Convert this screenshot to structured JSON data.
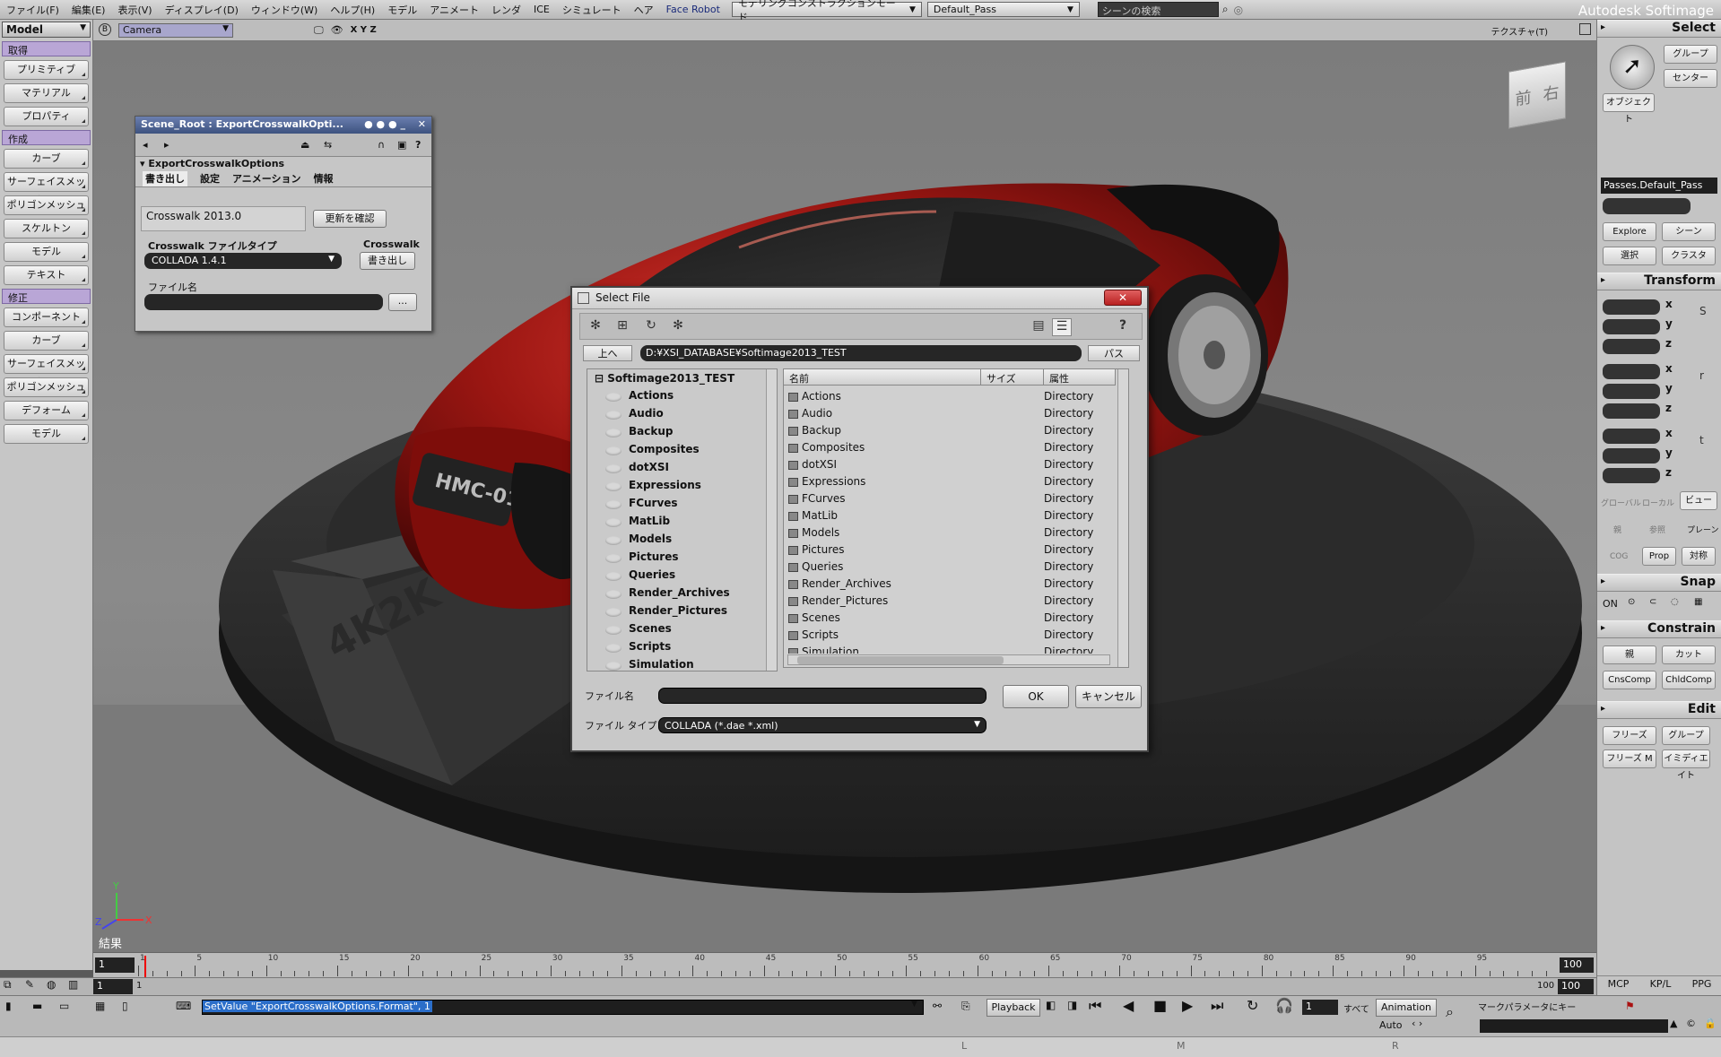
{
  "menubar": {
    "items": [
      "ファイル(F)",
      "編集(E)",
      "表示(V)",
      "ディスプレイ(D)",
      "ウィンドウ(W)",
      "ヘルプ(H)",
      "モデル",
      "アニメート",
      "レンダ",
      "ICE",
      "シミュレート",
      "ヘア",
      "Face Robot"
    ],
    "mode_dropdown": "モデリングコンストラクションモード",
    "pass_dropdown": "Default_Pass",
    "search_placeholder": "シーンの検索",
    "brand": "Autodesk Softimage"
  },
  "left_toolbar": {
    "mode": "Model",
    "sections": [
      {
        "title": "取得",
        "buttons": [
          "プリミティブ",
          "マテリアル",
          "プロパティ"
        ]
      },
      {
        "title": "作成",
        "buttons": [
          "カーブ",
          "サーフェイスメッシュ",
          "ポリゴンメッシュ",
          "スケルトン",
          "モデル",
          "テキスト"
        ]
      },
      {
        "title": "修正",
        "buttons": [
          "コンポーネント",
          "カーブ",
          "サーフェイスメッシュ",
          "ポリゴンメッシュ",
          "デフォーム",
          "モデル"
        ]
      }
    ]
  },
  "viewport": {
    "camera": "Camera",
    "axes": "X Y Z",
    "texture_label": "テクスチャ(T)",
    "result_label": "結果",
    "cube_labels": [
      "前",
      "右"
    ],
    "plate_text": "HMC-01",
    "pedestal_text": "4K2K"
  },
  "property_panel": {
    "title": "Scene_Root : ExportCrosswalkOpti...",
    "section": "ExportCrosswalkOptions",
    "tabs": [
      "書き出し",
      "設定",
      "アニメーション",
      "情報"
    ],
    "version": "Crosswalk 2013.0",
    "update_button": "更新を確認",
    "filetype_label": "Crosswalk ファイルタイプ",
    "filetype_value": "COLLADA 1.4.1",
    "crosswalk_label": "Crosswalk",
    "export_button": "書き出し",
    "filename_label": "ファイル名",
    "browse_button": "..."
  },
  "dialog": {
    "title": "Select File",
    "close": "✕",
    "up_button": "上へ",
    "path": "D:¥XSI_DATABASE¥Softimage2013_TEST",
    "path_button": "パス",
    "tree_root": "Softimage2013_TEST",
    "tree_items": [
      "Actions",
      "Audio",
      "Backup",
      "Composites",
      "dotXSI",
      "Expressions",
      "FCurves",
      "MatLib",
      "Models",
      "Pictures",
      "Queries",
      "Render_Archives",
      "Render_Pictures",
      "Scenes",
      "Scripts",
      "Simulation"
    ],
    "columns": [
      "名前",
      "サイズ",
      "属性"
    ],
    "files": [
      {
        "name": "Actions",
        "attr": "Directory"
      },
      {
        "name": "Audio",
        "attr": "Directory"
      },
      {
        "name": "Backup",
        "attr": "Directory"
      },
      {
        "name": "Composites",
        "attr": "Directory"
      },
      {
        "name": "dotXSI",
        "attr": "Directory"
      },
      {
        "name": "Expressions",
        "attr": "Directory"
      },
      {
        "name": "FCurves",
        "attr": "Directory"
      },
      {
        "name": "MatLib",
        "attr": "Directory"
      },
      {
        "name": "Models",
        "attr": "Directory"
      },
      {
        "name": "Pictures",
        "attr": "Directory"
      },
      {
        "name": "Queries",
        "attr": "Directory"
      },
      {
        "name": "Render_Archives",
        "attr": "Directory"
      },
      {
        "name": "Render_Pictures",
        "attr": "Directory"
      },
      {
        "name": "Scenes",
        "attr": "Directory"
      },
      {
        "name": "Scripts",
        "attr": "Directory"
      },
      {
        "name": "Simulation",
        "attr": "Directory"
      }
    ],
    "filename_label": "ファイル名",
    "filename_value": "",
    "filetype_label": "ファイル タイプ",
    "filetype_value": "COLLADA (*.dae *.xml)",
    "ok": "OK",
    "cancel": "キャンセル"
  },
  "right_panel": {
    "select_header": "Select",
    "group_button": "グループ",
    "center_button": "センター",
    "object_button": "オブジェクト",
    "pass_field": "Passes.Default_Pass",
    "explore_button": "Explore",
    "scene_button": "シーン",
    "select_button": "選択",
    "cluster_button": "クラスタ",
    "transform_header": "Transform",
    "axes": [
      "x",
      "y",
      "z"
    ],
    "ref_buttons": [
      "グローバル",
      "ローカル",
      "ビュー",
      "親",
      "参照",
      "プレーン",
      "COG",
      "Prop",
      "対称"
    ],
    "snap_header": "Snap",
    "snap_on": "ON",
    "constrain_header": "Constrain",
    "constrain_buttons": [
      "親",
      "カット",
      "CnsComp",
      "ChldComp"
    ],
    "edit_header": "Edit",
    "edit_buttons": [
      "フリーズ",
      "グループ",
      "フリーズ M",
      "イミディエイト"
    ],
    "bottom_tabs": [
      "MCP",
      "KP/L",
      "PPG"
    ]
  },
  "timeline": {
    "start": "1",
    "end": "100",
    "range_start": "1",
    "range_end": "100",
    "range_end2": "100",
    "ticks": [
      "1",
      "5",
      "10",
      "15",
      "20",
      "25",
      "30",
      "35",
      "40",
      "45",
      "50",
      "55",
      "60",
      "65",
      "70",
      "75",
      "80",
      "85",
      "90",
      "95"
    ]
  },
  "bottombar": {
    "command": "SetValue \"ExportCrosswalkOptions.Format\", 1",
    "playback": "Playback",
    "frame": "1",
    "all_label": "すべて",
    "animation": "Animation",
    "auto": "Auto",
    "marker_label": "マークパラメータにキー"
  }
}
